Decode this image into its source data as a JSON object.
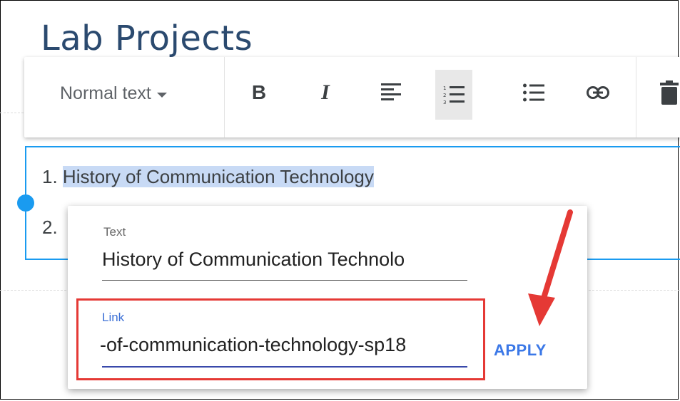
{
  "page": {
    "title": "Lab Projects"
  },
  "toolbar": {
    "text_style": "Normal text",
    "buttons": [
      {
        "name": "bold-button",
        "icon": "bold-icon",
        "glyph": "B"
      },
      {
        "name": "italic-button",
        "icon": "italic-icon",
        "glyph": "I"
      },
      {
        "name": "align-left-button",
        "icon": "align-left-icon"
      },
      {
        "name": "numbered-list-button",
        "icon": "numbered-list-icon",
        "active": true
      },
      {
        "name": "bulleted-list-button",
        "icon": "bulleted-list-icon"
      },
      {
        "name": "link-button",
        "icon": "link-icon"
      },
      {
        "name": "delete-button",
        "icon": "trash-icon"
      }
    ]
  },
  "editor": {
    "items": [
      {
        "number": "1.",
        "text": "History of Communication Technology",
        "selected": true
      },
      {
        "number": "2.",
        "text": ""
      }
    ]
  },
  "link_dialog": {
    "text_label": "Text",
    "text_value": "History of Communication Technolo",
    "link_label": "Link",
    "link_value": "-of-communication-technology-sp18",
    "apply_label": "APPLY"
  },
  "colors": {
    "title": "#2b4a6f",
    "selection": "#c8daf5",
    "editor_border": "#1a9bf0",
    "annotation_red": "#e53935",
    "apply_blue": "#3b78e7",
    "link_underline": "#3949ab"
  }
}
